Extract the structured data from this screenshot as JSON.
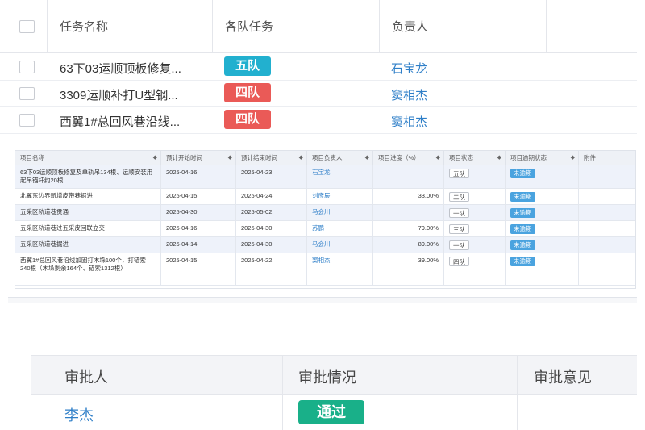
{
  "top_table": {
    "headers": {
      "task_name": "任务名称",
      "team_task": "各队任务",
      "owner": "负责人"
    },
    "rows": [
      {
        "name": "63下03运顺顶板修复...",
        "team": "五队",
        "team_color": "#22b0cf",
        "owner": "石宝龙"
      },
      {
        "name": "3309运顺补打U型钢...",
        "team": "四队",
        "team_color": "#ea5a57",
        "owner": "窦相杰"
      },
      {
        "name": "西翼1#总回风巷沿线...",
        "team": "四队",
        "team_color": "#ea5a57",
        "owner": "窦相杰"
      }
    ]
  },
  "mid_table": {
    "headers": {
      "project_name": "项目名称",
      "start": "预计开始时间",
      "end": "预计结束时间",
      "owner": "项目负责人",
      "progress": "项目进度（%）",
      "status": "项目状态",
      "overdue": "项目逾期状态",
      "attachment": "附件"
    },
    "sort_icon": "◆",
    "rows": [
      {
        "name": "63下03运顺顶板修复及单轨吊134根、运顺安装用起吊锚杆约20根",
        "start": "2025-04-16",
        "end": "2025-04-23",
        "owner": "石宝龙",
        "progress": "",
        "team": "五队",
        "overdue": "未逾期"
      },
      {
        "name": "北翼东边界新增皮带巷掘进",
        "start": "2025-04-15",
        "end": "2025-04-24",
        "owner": "刘彦辰",
        "progress": "33.00%",
        "team": "二队",
        "overdue": "未逾期"
      },
      {
        "name": "五采区轨道巷贯通",
        "start": "2025-04-30",
        "end": "2025-05-02",
        "owner": "马会川",
        "progress": "",
        "team": "一队",
        "overdue": "未逾期"
      },
      {
        "name": "五采区轨道巷过五采皮回联立交",
        "start": "2025-04-16",
        "end": "2025-04-30",
        "owner": "苏鹏",
        "progress": "79.00%",
        "team": "三队",
        "overdue": "未逾期"
      },
      {
        "name": "五采区轨道巷掘进",
        "start": "2025-04-14",
        "end": "2025-04-30",
        "owner": "马会川",
        "progress": "89.00%",
        "team": "一队",
        "overdue": "未逾期"
      },
      {
        "name": "西翼1#总回风巷沿线加固打木垛100个，打锚索240根（木垛剩余164个、锚索1312根）",
        "start": "2025-04-15",
        "end": "2025-04-22",
        "owner": "窦相杰",
        "progress": "39.00%",
        "team": "四队",
        "overdue": "未逾期"
      }
    ]
  },
  "approval_table": {
    "headers": {
      "approver": "审批人",
      "status": "审批情况",
      "opinion": "审批意见"
    },
    "rows": [
      {
        "approver": "李杰",
        "status": "通过",
        "status_color": "#19b089",
        "opinion": ""
      }
    ]
  }
}
